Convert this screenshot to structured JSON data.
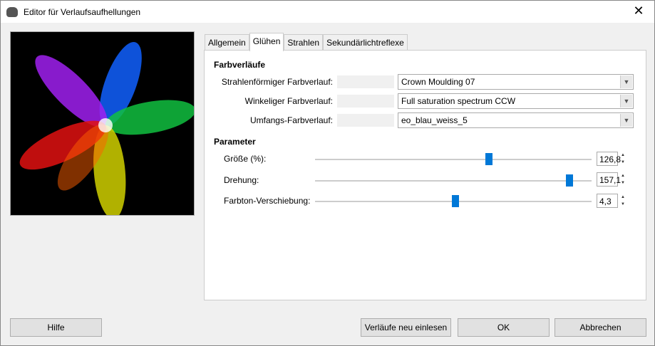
{
  "window": {
    "title": "Editor für Verlaufsaufhellungen",
    "close": "✕"
  },
  "tabs": [
    {
      "label": "Allgemein"
    },
    {
      "label": "Glühen"
    },
    {
      "label": "Strahlen"
    },
    {
      "label": "Sekundärlichtreflexe"
    }
  ],
  "gradients": {
    "heading": "Farbverläufe",
    "rows": [
      {
        "label": "Strahlenförmiger Farbverlauf:",
        "value": "Crown Moulding 07"
      },
      {
        "label": "Winkeliger Farbverlauf:",
        "value": "Full saturation spectrum CCW"
      },
      {
        "label": "Umfangs-Farbverlauf:",
        "value": "eo_blau_weiss_5"
      }
    ]
  },
  "parameters": {
    "heading": "Parameter",
    "rows": [
      {
        "label": "Größe (%):",
        "value": "126,8",
        "fraction": 0.63
      },
      {
        "label": "Drehung:",
        "value": "157,1",
        "fraction": 0.92
      },
      {
        "label": "Farbton-Verschiebung:",
        "value": "4,3",
        "fraction": 0.507
      }
    ]
  },
  "buttons": {
    "help": "Hilfe",
    "reload": "Verläufe neu einlesen",
    "ok": "OK",
    "cancel": "Abbrechen"
  },
  "colors": {
    "accent": "#0078d7"
  }
}
